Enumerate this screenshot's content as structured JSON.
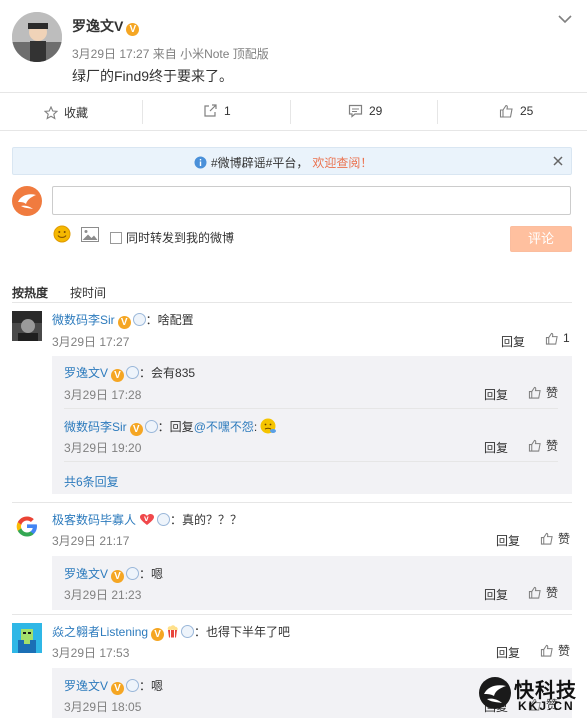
{
  "post": {
    "author": "罗逸文V",
    "meta_time": "3月29日 17:27",
    "meta_from": "来自",
    "meta_device": "小米Note 顶配版",
    "content": "绿厂的Find9终于要来了。",
    "verified_badge": "V"
  },
  "actions": {
    "favorite_label": "收藏",
    "forward_count": "1",
    "comment_count": "29",
    "like_count": "25"
  },
  "notice": {
    "prefix": "#微博辟谣#平台，",
    "link": "欢迎查阅！"
  },
  "composer": {
    "input_value": "",
    "also_forward_label": "同时转发到我的微博",
    "submit_label": "评论"
  },
  "sort": {
    "hot": "按热度",
    "time": "按时间"
  },
  "comments": [
    {
      "name": "微数码李Sir",
      "text": "：啥配置",
      "time": "3月29日 17:27",
      "reply_label": "回复",
      "like": "1",
      "replies": [
        {
          "name": "罗逸文V",
          "text": "：会有835",
          "time": "3月29日 17:28",
          "reply_label": "回复",
          "like": "赞"
        },
        {
          "name": "微数码李Sir",
          "text_pre": "：回复",
          "mention": "@不嘿不怨",
          "text_post": ":",
          "time": "3月29日 19:20",
          "reply_label": "回复",
          "like": "赞"
        }
      ],
      "more": "共6条回复"
    },
    {
      "name": "极客数码毕寡人",
      "text": "：真的？？？",
      "time": "3月29日 21:17",
      "reply_label": "回复",
      "like": "赞",
      "replies": [
        {
          "name": "罗逸文V",
          "text": "：嗯",
          "time": "3月29日 21:23",
          "reply_label": "回复",
          "like": "赞"
        }
      ]
    },
    {
      "name": "焱之翱者Listening",
      "text": "：也得下半年了吧",
      "time": "3月29日 17:53",
      "reply_label": "回复",
      "like": "赞",
      "replies": [
        {
          "name": "罗逸文V",
          "text": "：嗯",
          "time": "3月29日 18:05",
          "reply_label": "回复",
          "like": "赞"
        }
      ]
    }
  ],
  "watermark": {
    "cn": "快科技",
    "en": "KKJ.CN"
  },
  "colors": {
    "link_blue": "#2d7bbd",
    "accent_orange": "#eb7350",
    "submit_bg": "#ffc09f",
    "reply_bg": "#f2f2f5"
  }
}
